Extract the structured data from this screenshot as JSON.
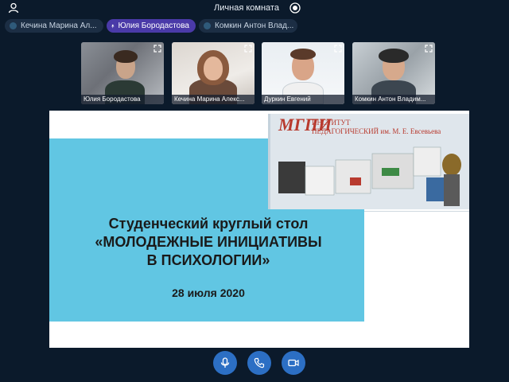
{
  "header": {
    "room_title": "Личная комната",
    "icons": [
      "user-icon",
      "record-icon"
    ]
  },
  "chips": [
    {
      "label": "Кечина Марина Ал...",
      "active": false
    },
    {
      "label": "Юлия Бородастова",
      "active": true
    },
    {
      "label": "Комкин Антон Влад...",
      "active": false
    }
  ],
  "tiles": [
    {
      "name": "Юлия Бородастова"
    },
    {
      "name": "Кечина Марина Алекс..."
    },
    {
      "name": "Дуркин Евгений"
    },
    {
      "name": "Комкин Антон Владим..."
    }
  ],
  "slide": {
    "logo_text": "ИНСТИТУТ\nПЕДАГОГИЧЕСКИЙ им. М. Е. Евсевьева",
    "logo_mark": "МГПИ",
    "title_line1": "Студенческий круглый стол",
    "title_line2": "«МОЛОДЕЖНЫЕ ИНИЦИАТИВЫ",
    "title_line3": "В ПСИХОЛОГИИ»",
    "date": "28 июля 2020"
  },
  "controls": {
    "icons": [
      "microphone-icon",
      "phone-icon",
      "camera-icon"
    ]
  },
  "colors": {
    "background": "#0b1a2b",
    "accent": "#2c6fc4",
    "active_chip": "#4a3aa8",
    "slide_blue": "#61c6e3"
  }
}
